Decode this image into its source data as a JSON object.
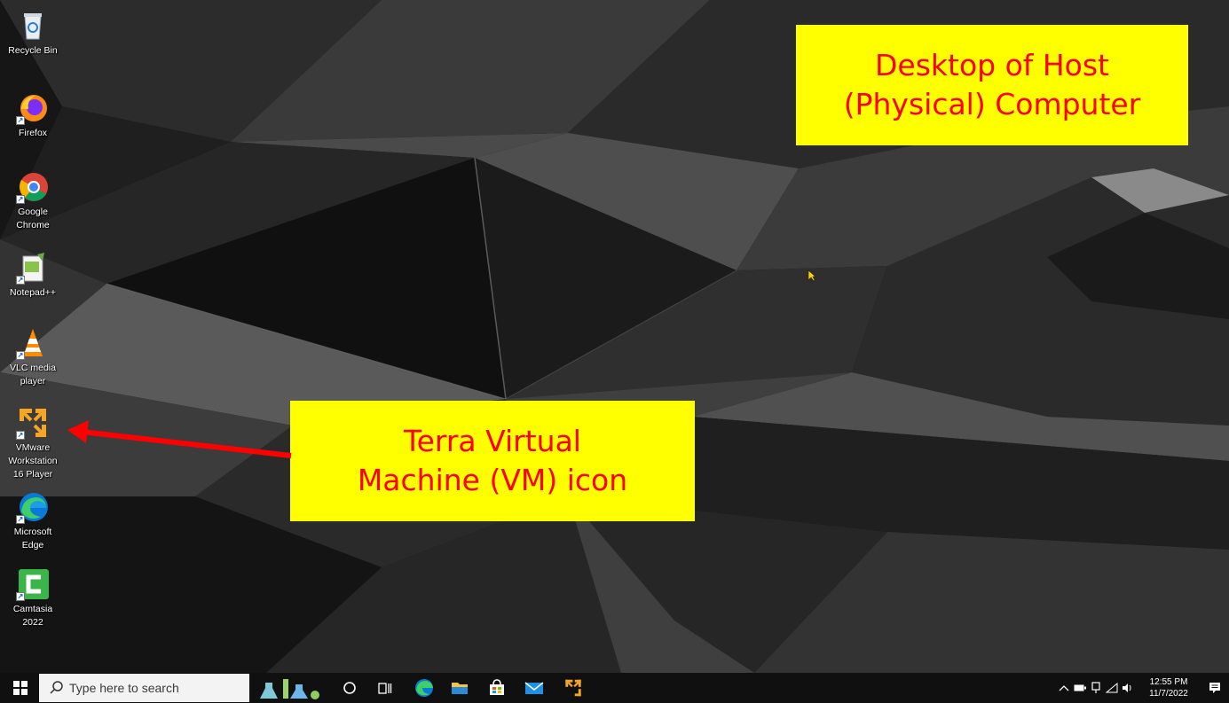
{
  "desktop_icons": [
    {
      "name": "Recycle Bin",
      "label_lines": [
        "Recycle Bin"
      ]
    },
    {
      "name": "Firefox",
      "label_lines": [
        "Firefox"
      ]
    },
    {
      "name": "Google Chrome",
      "label_lines": [
        "Google",
        "Chrome"
      ]
    },
    {
      "name": "Notepad++",
      "label_lines": [
        "Notepad++"
      ]
    },
    {
      "name": "VLC media player",
      "label_lines": [
        "VLC media",
        "player"
      ]
    },
    {
      "name": "VMware Workstation 16 Player",
      "label_lines": [
        "VMware",
        "Workstation",
        "16 Player"
      ]
    },
    {
      "name": "Microsoft Edge",
      "label_lines": [
        "Microsoft",
        "Edge"
      ]
    },
    {
      "name": "Camtasia 2022",
      "label_lines": [
        "Camtasia",
        "2022"
      ]
    }
  ],
  "callouts": {
    "host": {
      "line1": "Desktop of Host",
      "line2": "(Physical) Computer"
    },
    "vm": {
      "line1": "Terra Virtual",
      "line2": "Machine (VM) icon"
    }
  },
  "taskbar": {
    "search_placeholder": "Type here to search",
    "pinned_icons": [
      "start-icon",
      "search-icon",
      "cortana-icon",
      "task-view-icon",
      "edge-icon",
      "file-explorer-icon",
      "store-icon",
      "mail-icon",
      "vmware-icon"
    ],
    "clock": {
      "time": "12:55 PM",
      "date": "11/7/2022"
    },
    "tray_icons": [
      "chevron-up-icon",
      "battery-icon",
      "network-icon",
      "wifi-icon",
      "volume-icon",
      "notification-icon"
    ]
  },
  "colors": {
    "callout_bg": "#ffff00",
    "callout_text": "#ff0000",
    "arrow": "#ff0000",
    "taskbar_bg": "#101010"
  }
}
